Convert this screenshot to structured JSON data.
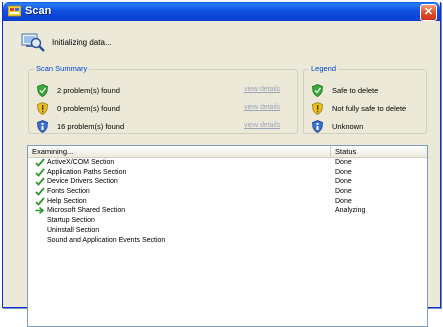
{
  "window": {
    "title": "Scan",
    "close_symbol": "✕"
  },
  "status": {
    "icon": "scan-search-icon",
    "text": "Initializing data..."
  },
  "summary": {
    "group_label": "Scan Summary",
    "rows": [
      {
        "icon": "green-shield-icon",
        "color": "#3aa83a",
        "text": "2 problem(s) found",
        "link": "view details"
      },
      {
        "icon": "yellow-shield-icon",
        "color": "#e8c020",
        "text": "0 problem(s) found",
        "link": "view details"
      },
      {
        "icon": "blue-shield-icon",
        "color": "#3a6fd8",
        "text": "16 problem(s) found",
        "link": "view details"
      }
    ]
  },
  "legend": {
    "group_label": "Legend",
    "rows": [
      {
        "icon": "green-shield-icon",
        "color": "#3aa83a",
        "text": "Safe to delete"
      },
      {
        "icon": "yellow-shield-icon",
        "color": "#e8c020",
        "text": "Not fully safe to delete"
      },
      {
        "icon": "blue-shield-icon",
        "color": "#3a6fd8",
        "text": "Unknown"
      }
    ]
  },
  "list": {
    "columns": [
      "Examining...",
      "Status"
    ],
    "rows": [
      {
        "mark": "check",
        "name": "ActiveX/COM Section",
        "status": "Done"
      },
      {
        "mark": "check",
        "name": "Application Paths Section",
        "status": "Done"
      },
      {
        "mark": "check",
        "name": "Device Drivers Section",
        "status": "Done"
      },
      {
        "mark": "check",
        "name": "Fonts Section",
        "status": "Done"
      },
      {
        "mark": "check",
        "name": "Help Section",
        "status": "Done"
      },
      {
        "mark": "arrow",
        "name": "Microsoft Shared Section",
        "status": "Analyzing"
      },
      {
        "mark": "",
        "name": "Startup Section",
        "status": ""
      },
      {
        "mark": "",
        "name": "Uninstall Section",
        "status": ""
      },
      {
        "mark": "",
        "name": "Sound and Application Events Section",
        "status": ""
      }
    ]
  }
}
